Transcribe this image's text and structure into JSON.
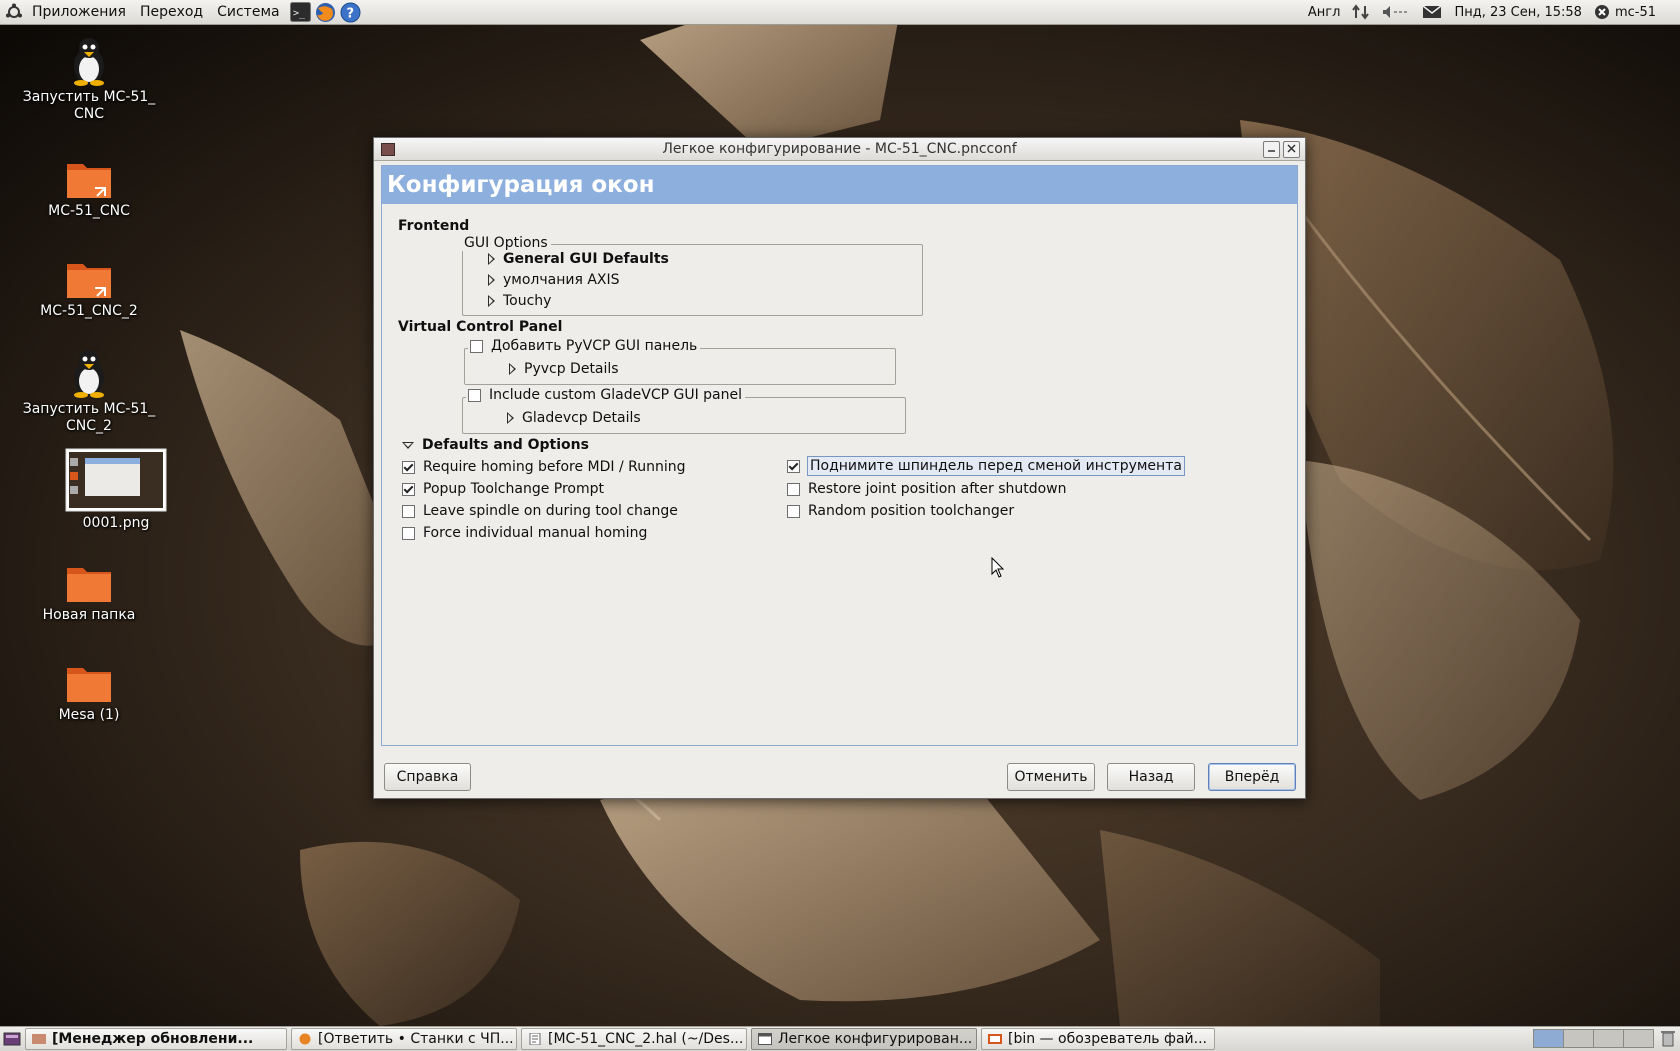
{
  "top_panel": {
    "menus": [
      "Приложения",
      "Переход",
      "Система"
    ],
    "keyboard_layout": "Англ",
    "clock": "Пнд, 23 Сен, 15:58",
    "user": "mc-51"
  },
  "desktop_icons": [
    {
      "label": "Запустить MC-51_ CNC",
      "icon": "penguin-icon"
    },
    {
      "label": "MC-51_CNC",
      "icon": "folder-link-icon"
    },
    {
      "label": "MC-51_CNC_2",
      "icon": "folder-link-icon"
    },
    {
      "label": "Запустить MC-51_ CNC_2",
      "icon": "penguin-icon"
    },
    {
      "label": "0001.png",
      "icon": "image-thumbnail-icon"
    },
    {
      "label": "Новая папка",
      "icon": "folder-icon"
    },
    {
      "label": "Mesa (1)",
      "icon": "folder-icon"
    }
  ],
  "window": {
    "title": "Легкое конфигурирование - MC-51_CNC.pncconf",
    "header": "Конфигурация окон",
    "frontend": {
      "section_title": "Frontend",
      "gui_options_legend": "GUI Options",
      "expanders": [
        "General GUI Defaults",
        "умолчания AXIS",
        "Touchy"
      ]
    },
    "vcp": {
      "section_title": "Virtual Control Panel",
      "pyvcp_checkbox": {
        "label": "Добавить PyVCP GUI панель",
        "checked": false
      },
      "pyvcp_details": "Pyvcp Details",
      "gladevcp_checkbox": {
        "label": "Include custom GladeVCP GUI panel",
        "checked": false
      },
      "gladevcp_details": "Gladevcp Details"
    },
    "defaults": {
      "section_title": "Defaults and Options",
      "left_options": [
        {
          "label": "Require homing before MDI / Running",
          "checked": true
        },
        {
          "label": "Popup Toolchange Prompt",
          "checked": true
        },
        {
          "label": "Leave spindle on during tool change",
          "checked": false
        },
        {
          "label": "Force individual manual homing",
          "checked": false
        }
      ],
      "right_options": [
        {
          "label": "Поднимите шпиндель перед сменой инструмента",
          "checked": true
        },
        {
          "label": "Restore joint position after shutdown",
          "checked": false
        },
        {
          "label": "Random position toolchanger",
          "checked": false
        }
      ]
    },
    "buttons": {
      "help": "Справка",
      "cancel": "Отменить",
      "back": "Назад",
      "forward": "Вперёд"
    }
  },
  "taskbar": {
    "tasks": [
      {
        "label": "[Менеджер обновлени...",
        "bold": true
      },
      {
        "label": "[Ответить • Станки с ЧП...",
        "bold": false
      },
      {
        "label": "[MC-51_CNC_2.hal (~/Des...",
        "bold": false
      },
      {
        "label": "Легкое конфигурирован...",
        "bold": false,
        "active": true
      },
      {
        "label": "[bin — обозреватель фай...",
        "bold": false
      }
    ]
  },
  "colors": {
    "header_banner": "#8cafdd",
    "wallpaper_tone": "#6b543d"
  }
}
